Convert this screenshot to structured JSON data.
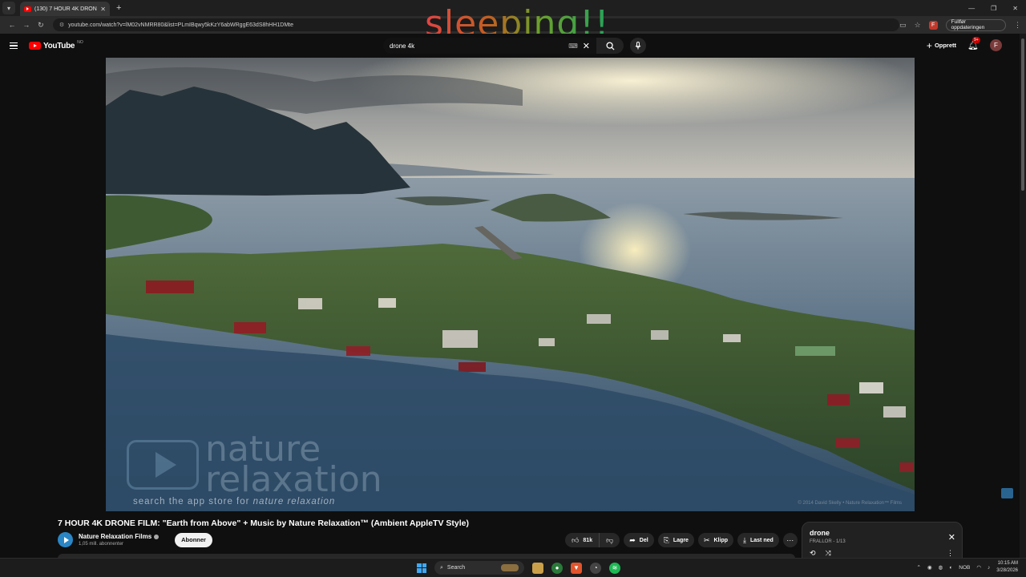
{
  "browser": {
    "tab_title": "(130) 7 HOUR 4K DRONE FILM",
    "url": "youtube.com/watch?v=lM02vNMRR80&list=PLmIBqwy5kKzY6abWRggE63dS8hHH1DMte",
    "update_button": "Fullfør oppdateringen",
    "profile_initial": "F"
  },
  "overlay_text": "sleeping!!",
  "header": {
    "logo_text": "YouTube",
    "region": "NO",
    "search_value": "drone 4k",
    "create_label": "Opprett",
    "notif_badge": "9+",
    "avatar_initial": "F"
  },
  "video": {
    "watermark_line1": "nature",
    "watermark_line2": "relaxation",
    "watermark_sub": "search the app store for ",
    "watermark_sub_em": "nature relaxation",
    "copyright": "© 2014 David Skelly • Nature Relaxation™ Films"
  },
  "meta": {
    "title": "7 HOUR 4K DRONE FILM: \"Earth from Above\" + Music by Nature Relaxation™ (Ambient AppleTV Style)",
    "channel_name": "Nature Relaxation Films",
    "subscribers": "1,05 mill. abonnenter",
    "subscribe_label": "Abonner",
    "likes": "81k",
    "share_label": "Del",
    "save_label": "Lagre",
    "clip_label": "Klipp",
    "download_label": "Last ned"
  },
  "playlist": {
    "title": "drone",
    "subtitle": "FRALLOR - 1/13"
  },
  "taskbar": {
    "search_label": "Search",
    "lang": "NOB",
    "time": "10:15 AM",
    "date": "3/28/2026"
  }
}
